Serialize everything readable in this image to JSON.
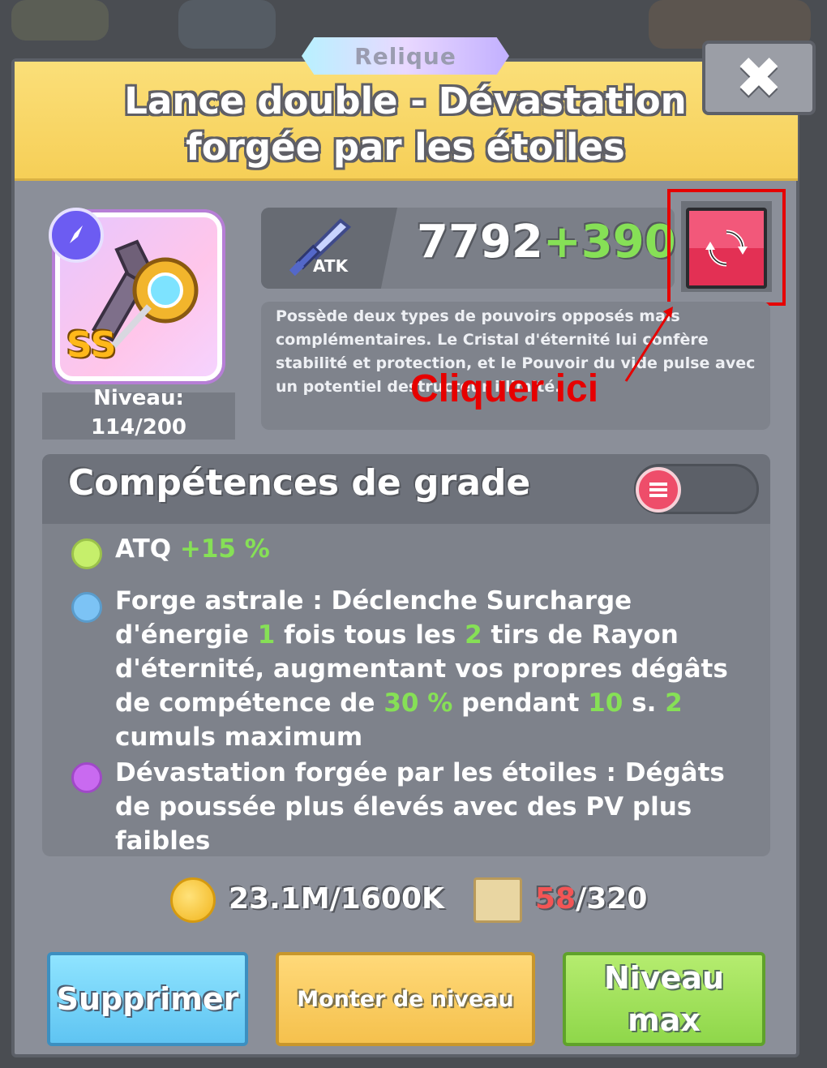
{
  "dialog": {
    "category_tag": "Relique",
    "title_line1": "Lance double - Dévastation",
    "title_line2": "forgée par les étoiles",
    "close_label": "✖"
  },
  "item": {
    "grade": "SS",
    "level_label": "Niveau:",
    "level_value": "114/200"
  },
  "stats": {
    "atk_label": "ATK",
    "atk_base": "7792",
    "atk_bonus": "+390"
  },
  "description": "Possède deux types de pouvoirs opposés mais complémentaires. Le Cristal d'éternité lui confère stabilité et protection, et le Pouvoir du vide pulse avec un potentiel destructeur illimité.",
  "annotation": {
    "text": "Cliquer ici",
    "color": "#e60000"
  },
  "skills": {
    "title": "Compétences de grade",
    "items": [
      {
        "dot_color": "#c6ef6b",
        "parts": [
          "ATQ ",
          "+15 %"
        ]
      },
      {
        "dot_color": "#7cc3f5",
        "parts": [
          "Forge astrale : Déclenche Surcharge d'énergie ",
          "1",
          " fois tous les ",
          "2",
          " tirs de Rayon d'éternité, augmentant vos propres dégâts de compétence de ",
          "30 %",
          " pendant ",
          "10",
          " s. ",
          "2",
          " cumuls maximum"
        ]
      },
      {
        "dot_color": "#c96af0",
        "parts": [
          "Dévastation forgée par les étoiles : Dégâts de poussée plus élevés avec des PV plus faibles"
        ]
      }
    ]
  },
  "costs": {
    "gold": "23.1M/1600K",
    "scroll_have": "58",
    "scroll_need": "/320"
  },
  "buttons": {
    "delete": "Supprimer",
    "level_up": "Monter de niveau",
    "max_level": "Niveau max"
  }
}
